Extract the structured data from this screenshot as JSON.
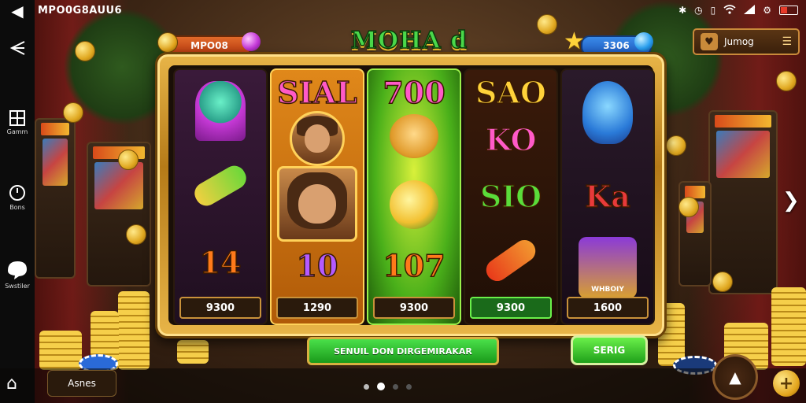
{
  "status_bar": {
    "title": "MPO0G8AUU6",
    "icons": [
      "bluetooth-icon",
      "alarm-icon",
      "vibrate-icon",
      "wifi-icon",
      "signal-icon",
      "settings-icon",
      "battery-icon"
    ]
  },
  "left_nav": {
    "items": [
      {
        "label": "Gamm",
        "icon": "grid-icon"
      },
      {
        "label": "Bons",
        "icon": "clock-icon"
      },
      {
        "label": "Swstiler",
        "icon": "chat-icon"
      }
    ]
  },
  "top": {
    "coins_label": "MPO08",
    "gems_label": "3306",
    "game_title": "MOHA d",
    "profile_label": "Jumog"
  },
  "reels": [
    {
      "top": "",
      "mid": "",
      "bottom_text": "14",
      "value": "9300"
    },
    {
      "top": "SIAL",
      "mid": "",
      "bottom_text": "10",
      "value": "1290"
    },
    {
      "top": "700",
      "mid": "",
      "bottom_text": "107",
      "value": "9300"
    },
    {
      "top": "SAO",
      "mid_text": "KO",
      "lower_text": "SIO",
      "value": "9300"
    },
    {
      "top": "",
      "mid_text": "Ka",
      "badge_text": "WHBOIY",
      "value": "1600"
    }
  ],
  "bottom": {
    "banner": "SENUIL DON DIRGEMIRAKAR",
    "send_button": "SERIG",
    "back_button": "Asnes",
    "page_dots": 4,
    "active_dot": 2
  },
  "colors": {
    "frame_gold": "#e8b548",
    "banner_green": "#1a9a1a",
    "pill_orange": "#e06a2a",
    "pill_blue": "#3a8ae8"
  }
}
